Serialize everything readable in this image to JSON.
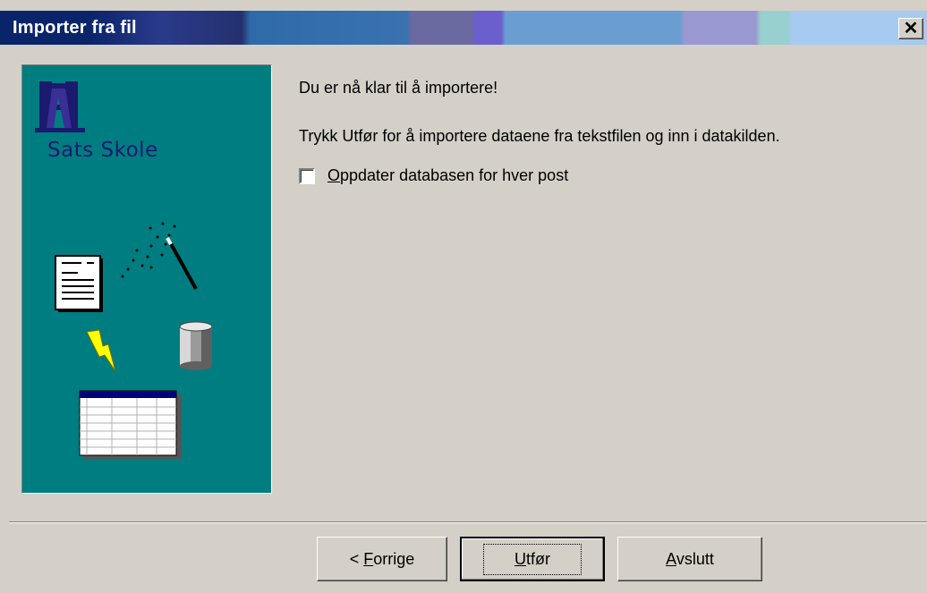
{
  "window": {
    "title": "Importer fra fil",
    "close_label": "✕"
  },
  "left_panel": {
    "brand_text": "Sats Skole"
  },
  "content": {
    "heading": "Du er nå klar til å importere!",
    "instruction": "Trykk Utfør for å importere dataene fra tekstfilen og inn i datakilden.",
    "checkbox": {
      "label_accel": "O",
      "label_rest": "ppdater databasen for hver post",
      "checked": false
    }
  },
  "buttons": {
    "back": {
      "prefix": "< ",
      "accel": "F",
      "rest": "orrige"
    },
    "finish": {
      "accel": "U",
      "rest": "tfør"
    },
    "exit": {
      "accel": "A",
      "rest": "vslutt"
    }
  },
  "colors": {
    "panel_bg": "#007d80",
    "dialog_bg": "#d4d0c8",
    "title_dark": "#0a246a"
  }
}
